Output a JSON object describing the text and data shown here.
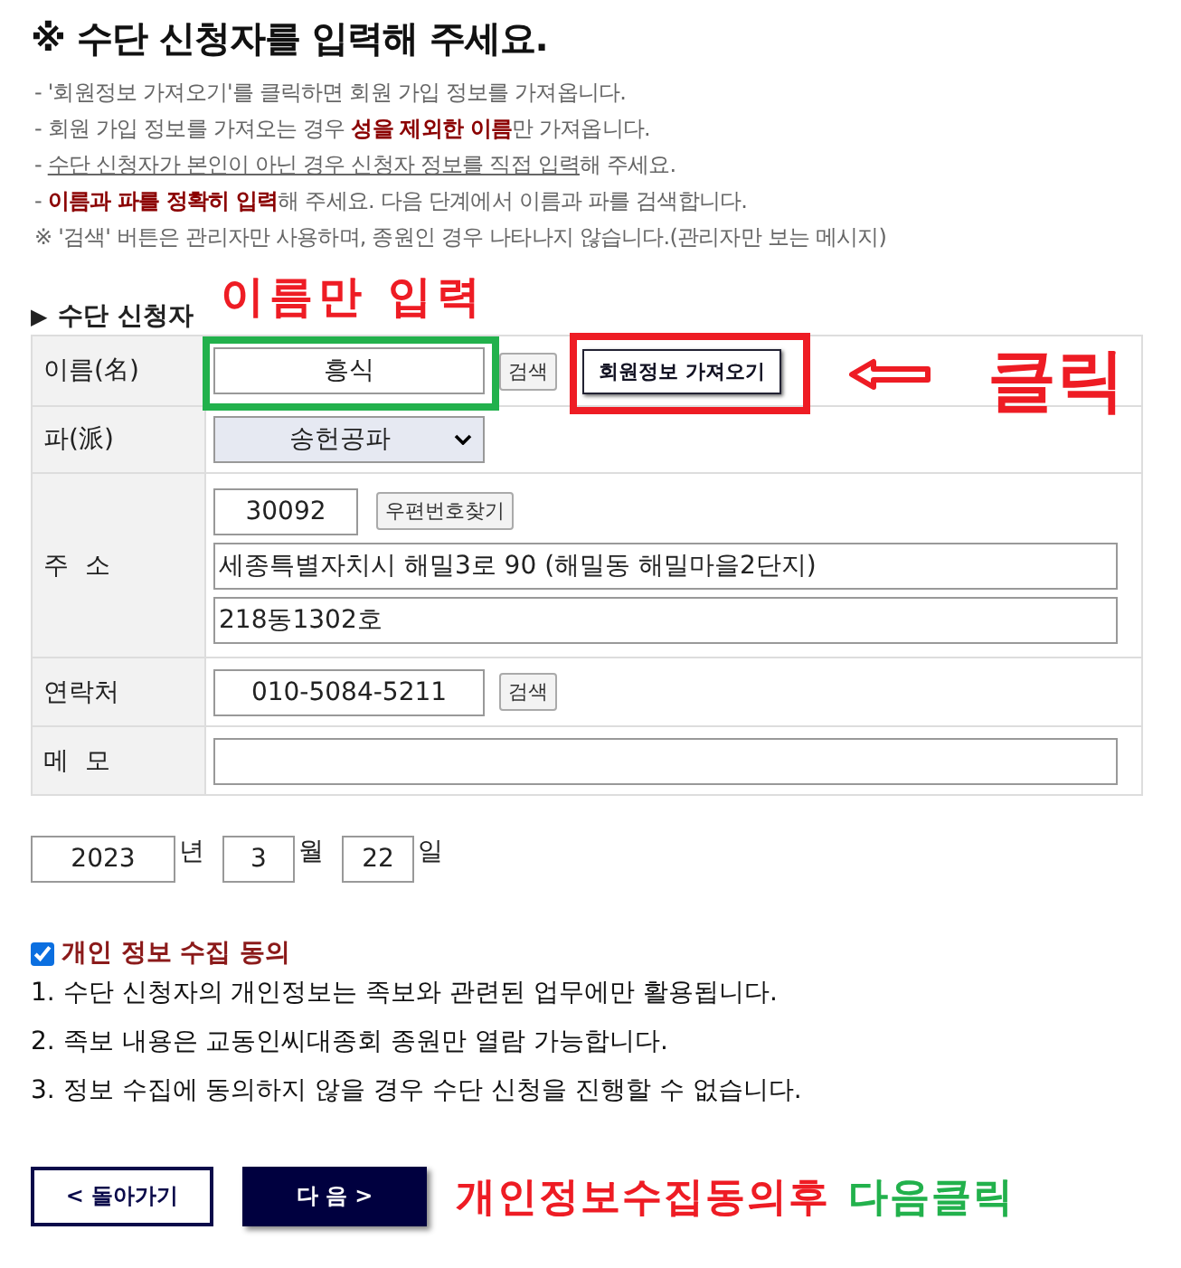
{
  "title": "※ 수단 신청자를 입력해 주세요.",
  "notes": [
    {
      "kind": "plain",
      "text": "- '회원정보 가져오기'를 클릭하면 회원 가입 정보를 가져옵니다."
    },
    {
      "kind": "plain",
      "text": "- 회원 가입 정보를 가져오는 경우 **성을 제외한 이름**만 가져옵니다."
    },
    {
      "kind": "underline",
      "prefix": "- ",
      "underlined": "수단 신청자가 본인이 아닌 경우 신청자 정보를 직접 입력",
      "text": "해 주세요."
    },
    {
      "kind": "plain",
      "text": "- **이름과 파를 정확히 입력**해 주세요. 다음 단계에서 이름과 파를 검색합니다."
    },
    {
      "kind": "plain",
      "text": "※ '검색' 버튼은 관리자만 사용하며, 종원인 경우 나타나지 않습니다.(관리자만 보는 메시지)"
    }
  ],
  "section": {
    "marker": "▶",
    "title": "수단 신청자"
  },
  "form": {
    "name": {
      "label": "이름(名)",
      "value": "흥식",
      "search_button": "검색",
      "fetch_button": "회원정보 가져오기"
    },
    "branch": {
      "label": "파(派)",
      "value": "송헌공파"
    },
    "address": {
      "label": "주  소",
      "zip": "30092",
      "zip_button": "우편번호찾기",
      "line1": "세종특별자치시 해밀3로 90 (해밀동 해밀마을2단지)",
      "line2": "218동1302호"
    },
    "contact": {
      "label": "연락처",
      "value": "010-5084-5211",
      "search_button": "검색"
    },
    "memo": {
      "label": "메  모"
    }
  },
  "date": {
    "year": "2023",
    "year_unit": "년",
    "month": "3",
    "month_unit": "월",
    "day": "22",
    "day_unit": "일"
  },
  "consent": {
    "checked": true,
    "title": "개인 정보 수집 동의",
    "items": [
      "1. 수단 신청자의 개인정보는 족보와 관련된 업무에만 활용됩니다.",
      "2. 족보 내용은 교동인씨대종회 종원만 열람 가능합니다.",
      "3. 정보 수집에 동의하지 않을 경우 수단 신청을 진행할 수 없습니다."
    ]
  },
  "buttons": {
    "back": "< 돌아가기",
    "next": "다 음 >"
  },
  "annotations": {
    "name_hint": "이름만 입력",
    "click": "클릭",
    "bottom": [
      {
        "text": "개인정보수집동의후",
        "color": "#ee1c24"
      },
      {
        "text": "다음클릭",
        "color": "#22b14c"
      }
    ]
  }
}
